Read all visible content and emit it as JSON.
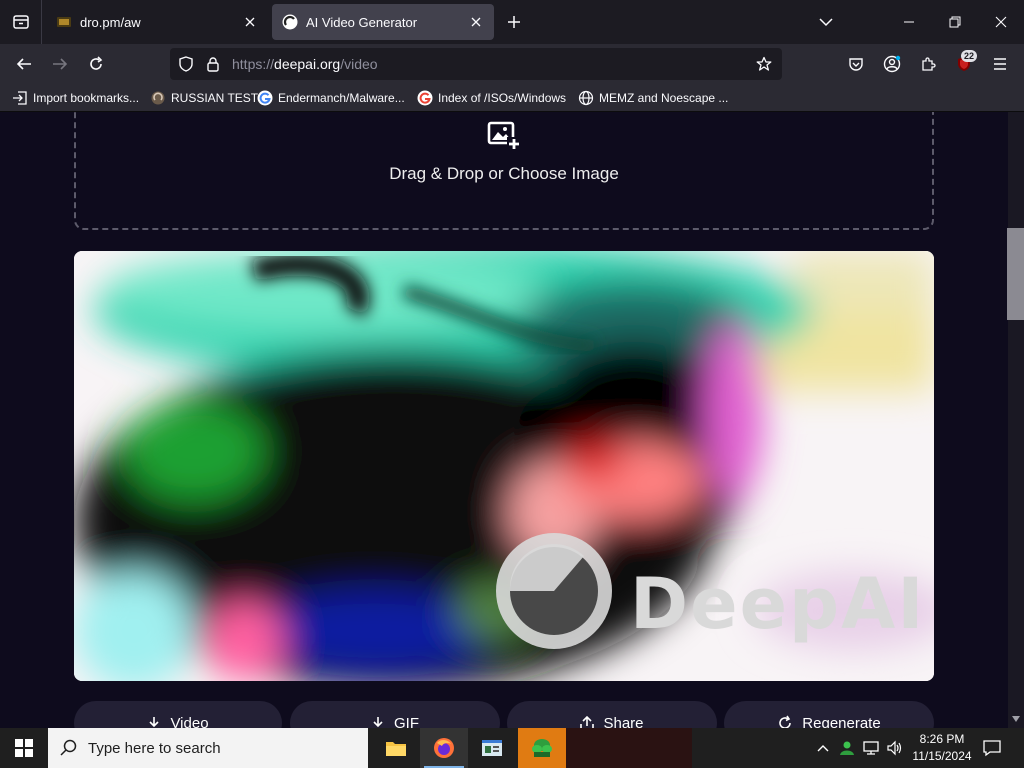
{
  "browser": {
    "tabs": [
      {
        "title": "dro.pm/aw",
        "active": false
      },
      {
        "title": "AI Video Generator",
        "active": true
      }
    ],
    "url": {
      "scheme": "https://",
      "host": "deepai.org",
      "path": "/video"
    },
    "extensions_badge": "22",
    "bookmarks": [
      {
        "label": "Import bookmarks...",
        "icon": "import-icon"
      },
      {
        "label": "RUSSIAN TEST",
        "icon": "shield-icon"
      },
      {
        "label": "Endermanch/Malware...",
        "icon": "google-icon"
      },
      {
        "label": "Index of /ISOs/Windows",
        "icon": "google-icon"
      },
      {
        "label": "MEMZ and Noescape ...",
        "icon": "globe-icon"
      }
    ]
  },
  "page": {
    "dropzone_text": "Drag & Drop or Choose Image",
    "watermark": "DeepAI",
    "actions": [
      {
        "label": "Video",
        "icon": "download-icon"
      },
      {
        "label": "GIF",
        "icon": "download-icon"
      },
      {
        "label": "Share",
        "icon": "share-icon"
      },
      {
        "label": "Regenerate",
        "icon": "refresh-icon"
      }
    ]
  },
  "taskbar": {
    "search_placeholder": "Type here to search",
    "time": "8:26 PM",
    "date": "11/15/2024"
  },
  "colors": {
    "page_bg": "#0e0b1d",
    "tab_active": "#42414d",
    "toolbar": "#2b2a33",
    "taskbar": "#1f1f1f"
  }
}
